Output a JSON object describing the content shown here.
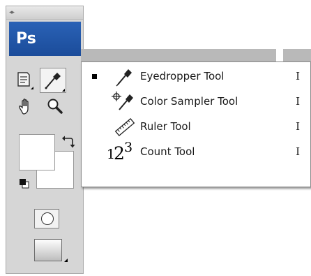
{
  "app": {
    "logo_text": "Ps"
  },
  "toolbox": {
    "tools": [
      {
        "name": "notes-tool",
        "icon": "note-icon"
      },
      {
        "name": "eyedropper-tool",
        "icon": "eyedropper-icon",
        "active": true
      },
      {
        "name": "hand-tool",
        "icon": "hand-icon"
      },
      {
        "name": "zoom-tool",
        "icon": "magnifier-icon"
      }
    ],
    "colors": {
      "foreground": "#ffffff",
      "background": "#ffffff"
    },
    "quick_mask_icon": "circle-in-square-icon",
    "screen_mode_icon": "screen-mode-icon"
  },
  "flyout_menu": {
    "items": [
      {
        "label": "Eyedropper Tool",
        "shortcut": "I",
        "selected": true,
        "icon": "eyedropper-icon"
      },
      {
        "label": "Color Sampler Tool",
        "shortcut": "I",
        "selected": false,
        "icon": "color-sampler-icon"
      },
      {
        "label": "Ruler Tool",
        "shortcut": "I",
        "selected": false,
        "icon": "ruler-icon"
      },
      {
        "label": "Count Tool",
        "shortcut": "I",
        "selected": false,
        "icon": "count-icon",
        "icon_text": [
          "1",
          "2",
          "3"
        ]
      }
    ]
  },
  "colors": {
    "ps_blue": "#1b4c9a",
    "menu_bg": "#ffffff",
    "panel_bg": "#d6d6d6"
  }
}
